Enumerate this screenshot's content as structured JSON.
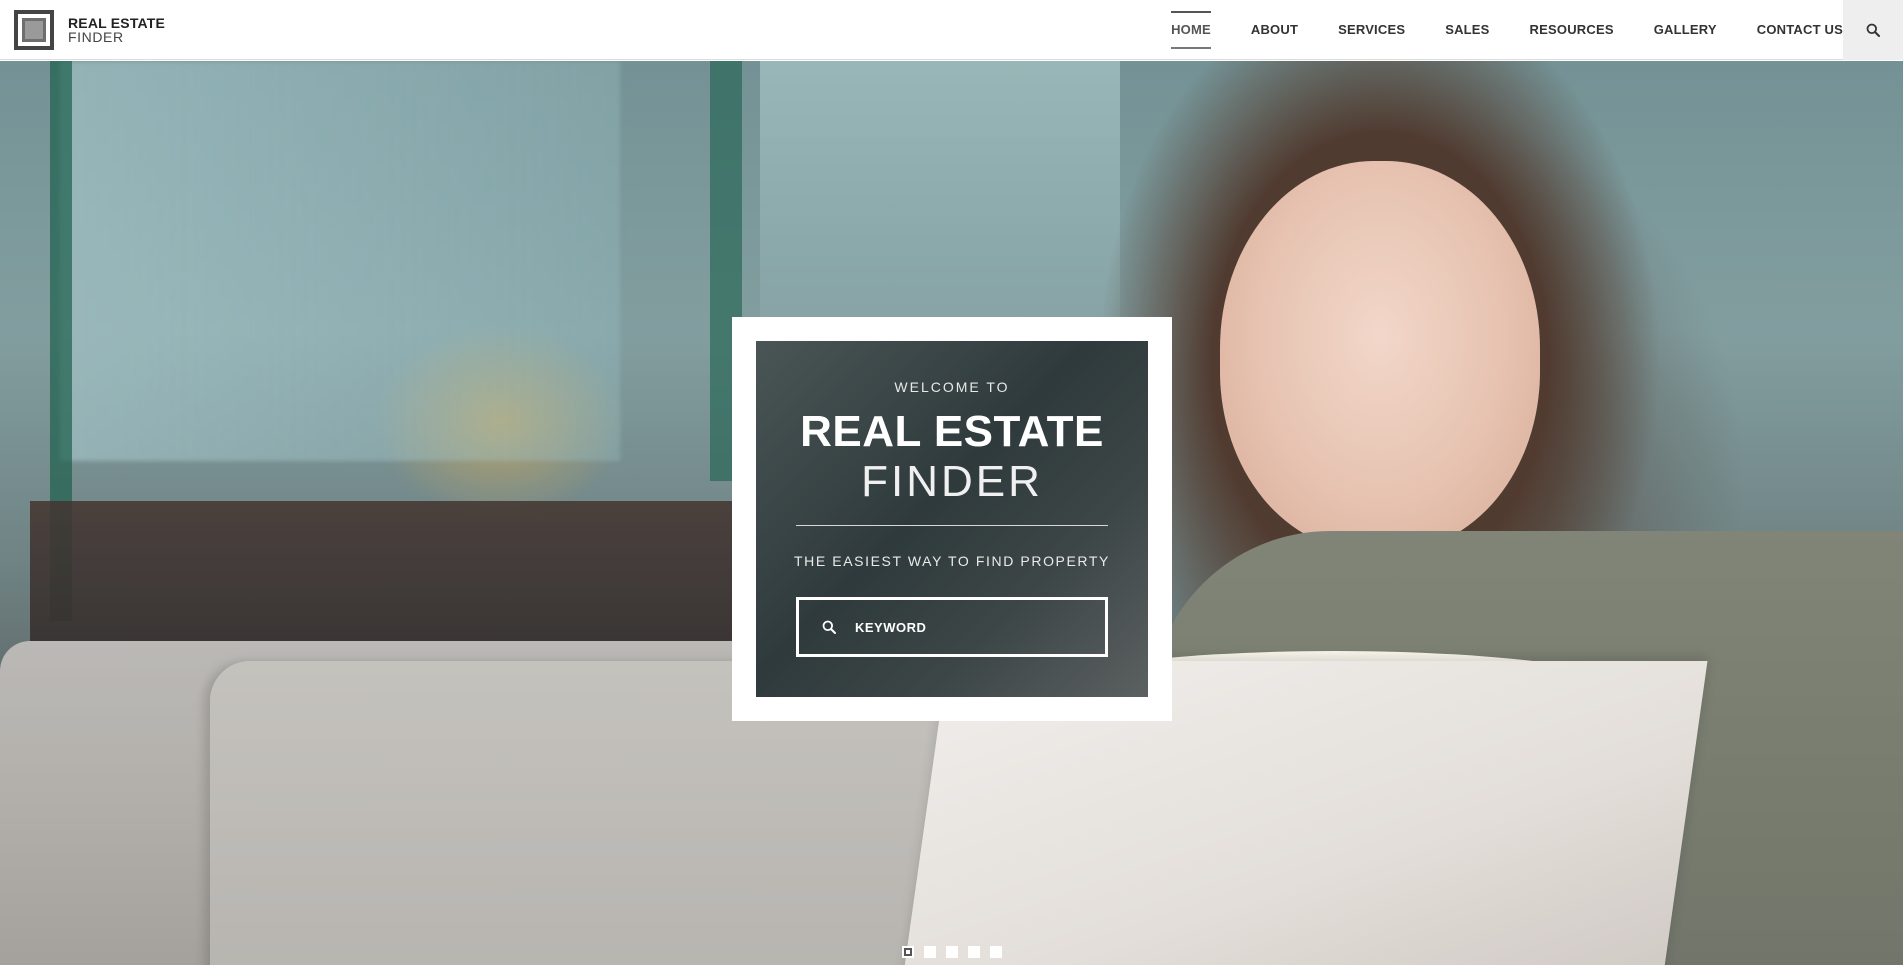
{
  "brand": {
    "name_line1": "REAL ESTATE",
    "name_line2": "FINDER",
    "logo_icon": "square-frame-logo"
  },
  "nav": {
    "items": [
      {
        "label": "HOME",
        "active": true
      },
      {
        "label": "ABOUT",
        "active": false
      },
      {
        "label": "SERVICES",
        "active": false
      },
      {
        "label": "SALES",
        "active": false
      },
      {
        "label": "RESOURCES",
        "active": false
      },
      {
        "label": "GALLERY",
        "active": false
      },
      {
        "label": "CONTACT US",
        "active": false
      }
    ],
    "search_icon": "search-icon"
  },
  "hero": {
    "welcome": "WELCOME TO",
    "title_bold": "REAL ESTATE",
    "title_light": "FINDER",
    "tagline": "THE EASIEST WAY TO FIND PROPERTY",
    "search": {
      "placeholder": "KEYWORD",
      "value": "",
      "icon": "search-icon"
    }
  },
  "slider": {
    "slide_count": 5,
    "active_index": 0
  },
  "colors": {
    "header_bg": "#ffffff",
    "nav_text": "#333333",
    "card_frame": "#ffffff",
    "card_panel": "#2f3a3c",
    "search_button_bg": "#eeeeee"
  }
}
